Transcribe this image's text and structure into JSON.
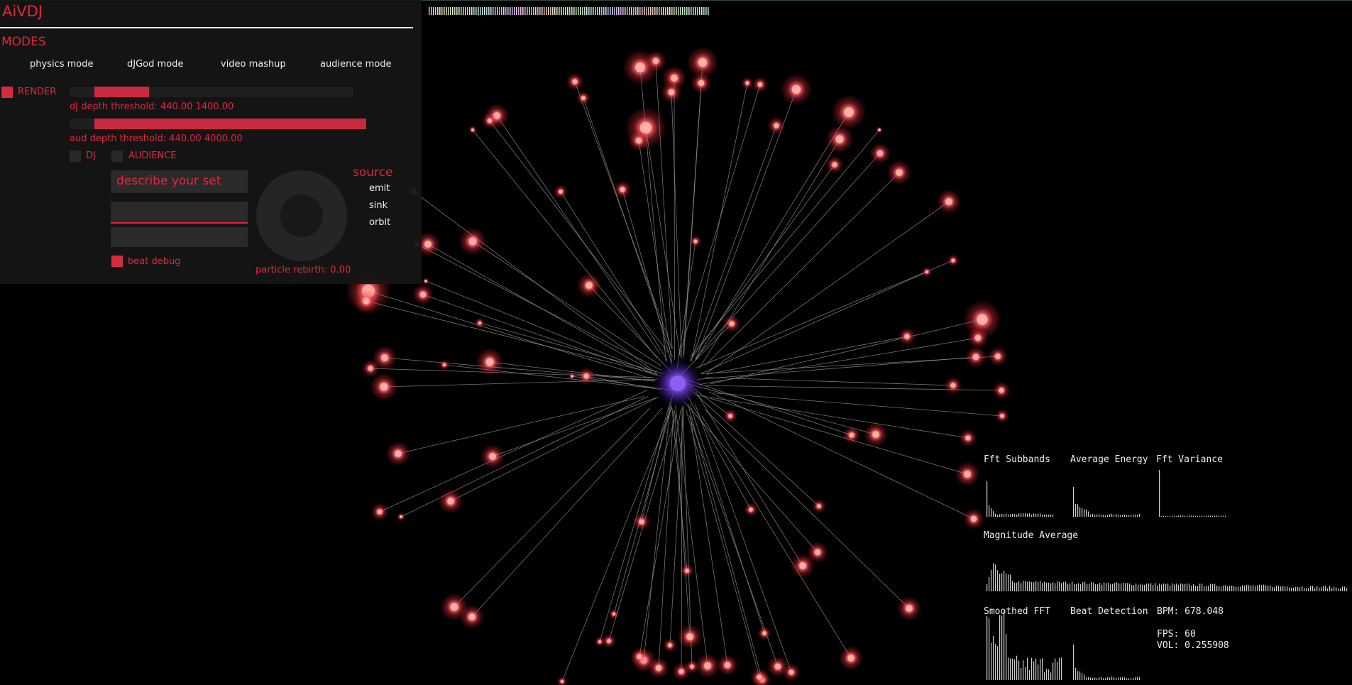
{
  "app": {
    "title": "AiVDJ"
  },
  "modes": {
    "label": "MODES",
    "buttons": [
      "physics mode",
      "dJGod mode",
      "video mashup",
      "audience mode"
    ]
  },
  "render": {
    "label": "RENDER",
    "checked": true
  },
  "dj_depth": {
    "label": "dJ depth threshold: 440.00 1400.00",
    "range": [
      440,
      1400
    ],
    "fill_start": 0.07,
    "fill_end": 0.23
  },
  "aud_depth": {
    "label": "aud depth threshold: 440.00 4000.00",
    "range": [
      440,
      4000
    ],
    "fill_start": 0.07,
    "fill_end": 0.65
  },
  "targets": {
    "dj_label": "DJ",
    "audience_label": "AUDIENCE",
    "dj_checked": false,
    "audience_checked": false
  },
  "describe": {
    "value": "describe your set",
    "field2": "",
    "field3": ""
  },
  "beat_debug": {
    "label": "beat debug",
    "checked": true
  },
  "particle": {
    "label": "particle rebirth: 0.00"
  },
  "source": {
    "label": "source",
    "options": [
      "emit",
      "sink",
      "orbit"
    ]
  },
  "analysis": {
    "fft_subbands": "Fft Subbands",
    "average_energy": "Average Energy",
    "fft_variance": "Fft Variance",
    "magnitude_average": "Magnitude Average",
    "smoothed_fft": "Smoothed FFT",
    "beat_detection": "Beat Detection",
    "bpm": "BPM: 678.048",
    "fps": "FPS: 60",
    "vol": "VOL: 0.255908"
  },
  "colors": {
    "accent": "#e0273f",
    "particle": "#ff5a5f",
    "core": "#7a4fd8",
    "line": "#9a9a9a"
  }
}
